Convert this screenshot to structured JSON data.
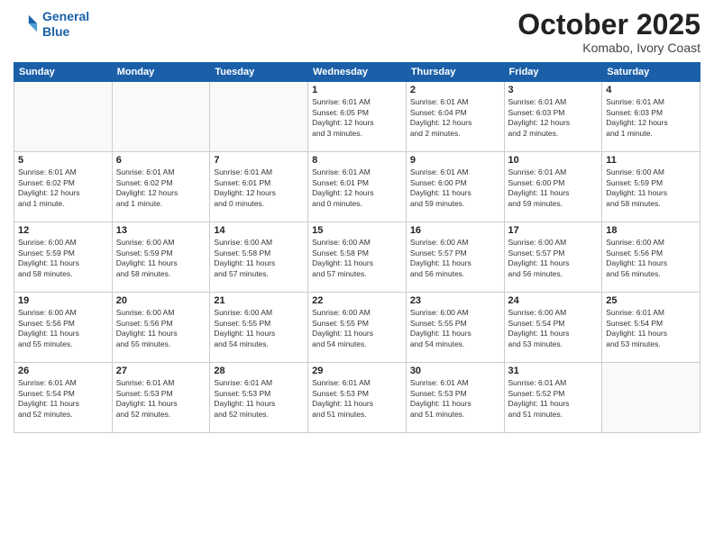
{
  "header": {
    "logo_line1": "General",
    "logo_line2": "Blue",
    "month": "October 2025",
    "location": "Komabo, Ivory Coast"
  },
  "weekdays": [
    "Sunday",
    "Monday",
    "Tuesday",
    "Wednesday",
    "Thursday",
    "Friday",
    "Saturday"
  ],
  "weeks": [
    [
      {
        "day": "",
        "info": ""
      },
      {
        "day": "",
        "info": ""
      },
      {
        "day": "",
        "info": ""
      },
      {
        "day": "1",
        "info": "Sunrise: 6:01 AM\nSunset: 6:05 PM\nDaylight: 12 hours\nand 3 minutes."
      },
      {
        "day": "2",
        "info": "Sunrise: 6:01 AM\nSunset: 6:04 PM\nDaylight: 12 hours\nand 2 minutes."
      },
      {
        "day": "3",
        "info": "Sunrise: 6:01 AM\nSunset: 6:03 PM\nDaylight: 12 hours\nand 2 minutes."
      },
      {
        "day": "4",
        "info": "Sunrise: 6:01 AM\nSunset: 6:03 PM\nDaylight: 12 hours\nand 1 minute."
      }
    ],
    [
      {
        "day": "5",
        "info": "Sunrise: 6:01 AM\nSunset: 6:02 PM\nDaylight: 12 hours\nand 1 minute."
      },
      {
        "day": "6",
        "info": "Sunrise: 6:01 AM\nSunset: 6:02 PM\nDaylight: 12 hours\nand 1 minute."
      },
      {
        "day": "7",
        "info": "Sunrise: 6:01 AM\nSunset: 6:01 PM\nDaylight: 12 hours\nand 0 minutes."
      },
      {
        "day": "8",
        "info": "Sunrise: 6:01 AM\nSunset: 6:01 PM\nDaylight: 12 hours\nand 0 minutes."
      },
      {
        "day": "9",
        "info": "Sunrise: 6:01 AM\nSunset: 6:00 PM\nDaylight: 11 hours\nand 59 minutes."
      },
      {
        "day": "10",
        "info": "Sunrise: 6:01 AM\nSunset: 6:00 PM\nDaylight: 11 hours\nand 59 minutes."
      },
      {
        "day": "11",
        "info": "Sunrise: 6:00 AM\nSunset: 5:59 PM\nDaylight: 11 hours\nand 58 minutes."
      }
    ],
    [
      {
        "day": "12",
        "info": "Sunrise: 6:00 AM\nSunset: 5:59 PM\nDaylight: 11 hours\nand 58 minutes."
      },
      {
        "day": "13",
        "info": "Sunrise: 6:00 AM\nSunset: 5:59 PM\nDaylight: 11 hours\nand 58 minutes."
      },
      {
        "day": "14",
        "info": "Sunrise: 6:00 AM\nSunset: 5:58 PM\nDaylight: 11 hours\nand 57 minutes."
      },
      {
        "day": "15",
        "info": "Sunrise: 6:00 AM\nSunset: 5:58 PM\nDaylight: 11 hours\nand 57 minutes."
      },
      {
        "day": "16",
        "info": "Sunrise: 6:00 AM\nSunset: 5:57 PM\nDaylight: 11 hours\nand 56 minutes."
      },
      {
        "day": "17",
        "info": "Sunrise: 6:00 AM\nSunset: 5:57 PM\nDaylight: 11 hours\nand 56 minutes."
      },
      {
        "day": "18",
        "info": "Sunrise: 6:00 AM\nSunset: 5:56 PM\nDaylight: 11 hours\nand 56 minutes."
      }
    ],
    [
      {
        "day": "19",
        "info": "Sunrise: 6:00 AM\nSunset: 5:56 PM\nDaylight: 11 hours\nand 55 minutes."
      },
      {
        "day": "20",
        "info": "Sunrise: 6:00 AM\nSunset: 5:56 PM\nDaylight: 11 hours\nand 55 minutes."
      },
      {
        "day": "21",
        "info": "Sunrise: 6:00 AM\nSunset: 5:55 PM\nDaylight: 11 hours\nand 54 minutes."
      },
      {
        "day": "22",
        "info": "Sunrise: 6:00 AM\nSunset: 5:55 PM\nDaylight: 11 hours\nand 54 minutes."
      },
      {
        "day": "23",
        "info": "Sunrise: 6:00 AM\nSunset: 5:55 PM\nDaylight: 11 hours\nand 54 minutes."
      },
      {
        "day": "24",
        "info": "Sunrise: 6:00 AM\nSunset: 5:54 PM\nDaylight: 11 hours\nand 53 minutes."
      },
      {
        "day": "25",
        "info": "Sunrise: 6:01 AM\nSunset: 5:54 PM\nDaylight: 11 hours\nand 53 minutes."
      }
    ],
    [
      {
        "day": "26",
        "info": "Sunrise: 6:01 AM\nSunset: 5:54 PM\nDaylight: 11 hours\nand 52 minutes."
      },
      {
        "day": "27",
        "info": "Sunrise: 6:01 AM\nSunset: 5:53 PM\nDaylight: 11 hours\nand 52 minutes."
      },
      {
        "day": "28",
        "info": "Sunrise: 6:01 AM\nSunset: 5:53 PM\nDaylight: 11 hours\nand 52 minutes."
      },
      {
        "day": "29",
        "info": "Sunrise: 6:01 AM\nSunset: 5:53 PM\nDaylight: 11 hours\nand 51 minutes."
      },
      {
        "day": "30",
        "info": "Sunrise: 6:01 AM\nSunset: 5:53 PM\nDaylight: 11 hours\nand 51 minutes."
      },
      {
        "day": "31",
        "info": "Sunrise: 6:01 AM\nSunset: 5:52 PM\nDaylight: 11 hours\nand 51 minutes."
      },
      {
        "day": "",
        "info": ""
      }
    ]
  ]
}
